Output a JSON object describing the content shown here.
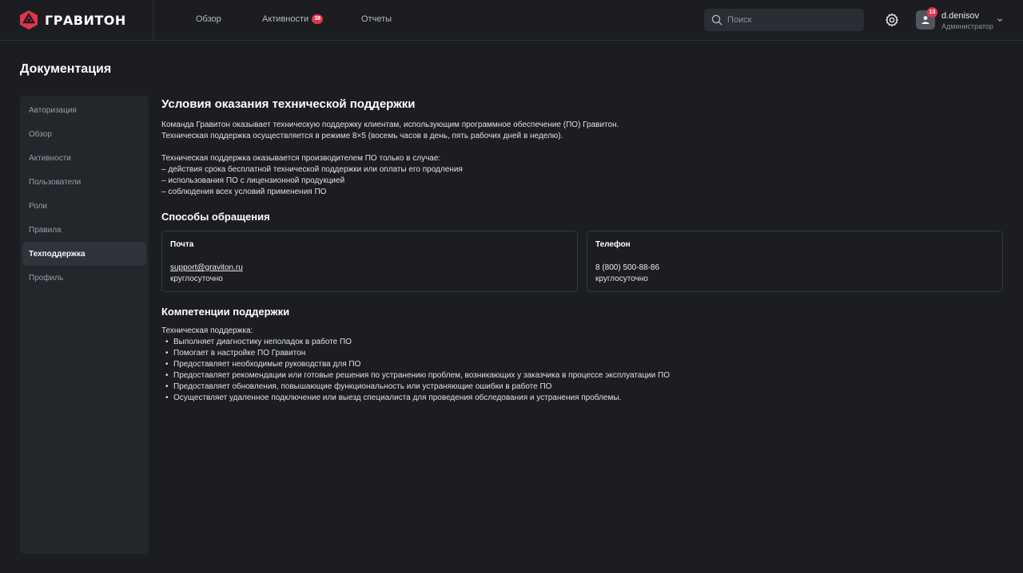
{
  "header": {
    "logo_text": "ГРАВИТОН",
    "nav": [
      {
        "label": "Обзор"
      },
      {
        "label": "Активности",
        "badge": "38"
      },
      {
        "label": "Отчеты"
      }
    ],
    "search_placeholder": "Поиск",
    "user": {
      "name": "d.denisov",
      "role": "Администратор",
      "notifications": "13"
    }
  },
  "page_title": "Документация",
  "sidebar": {
    "items": [
      {
        "label": "Авторизация"
      },
      {
        "label": "Обзор"
      },
      {
        "label": "Активности"
      },
      {
        "label": "Пользователи"
      },
      {
        "label": "Роли"
      },
      {
        "label": "Правила"
      },
      {
        "label": "Техподдержка",
        "active": true
      },
      {
        "label": "Профиль"
      }
    ]
  },
  "doc": {
    "title": "Условия оказания технической поддержки",
    "intro": [
      "Команда Гравитон оказывает техническую поддержку клиентам, использующим программное обеспечение (ПО) Гравитон.",
      "Техническая поддержка осуществляется в режиме 8×5 (восемь часов в день, пять рабочих дней в неделю)."
    ],
    "conditions": [
      "Техническая поддержка оказывается производителем ПО только в случае:",
      "– действия срока бесплатной технической поддержки или оплаты его продления",
      "– использования ПО с лицензионной продукцией",
      "– соблюдения всех условий применения ПО"
    ],
    "contact_title": "Способы обращения",
    "contacts": [
      {
        "title": "Почта",
        "value": "support@graviton.ru",
        "note": "круглосуточно"
      },
      {
        "title": "Телефон",
        "value": "8 (800) 500-88-86",
        "note": "круглосуточно"
      }
    ],
    "competence_title": "Компетенции поддержки",
    "competence_intro": "Техническая поддержка:",
    "competences": [
      "Выполняет диагностику неполадок в работе ПО",
      "Помогает в настройке ПО Гравитон",
      "Предоставляет необходимые руководства для ПО",
      "Предоставляет рекомендации или готовые решения по устранению проблем, возникающих у заказчика в процессе эксплуатации ПО",
      "Предоставляет обновления, повышающие функциональность или устраняющие ошибки в работе ПО",
      "Осуществляет удаленное подключение или выезд специалиста для проведения обследования и устранения проблемы."
    ]
  },
  "colors": {
    "accent": "#e5334b",
    "background": "#1b1d21",
    "panel": "#23262b"
  }
}
